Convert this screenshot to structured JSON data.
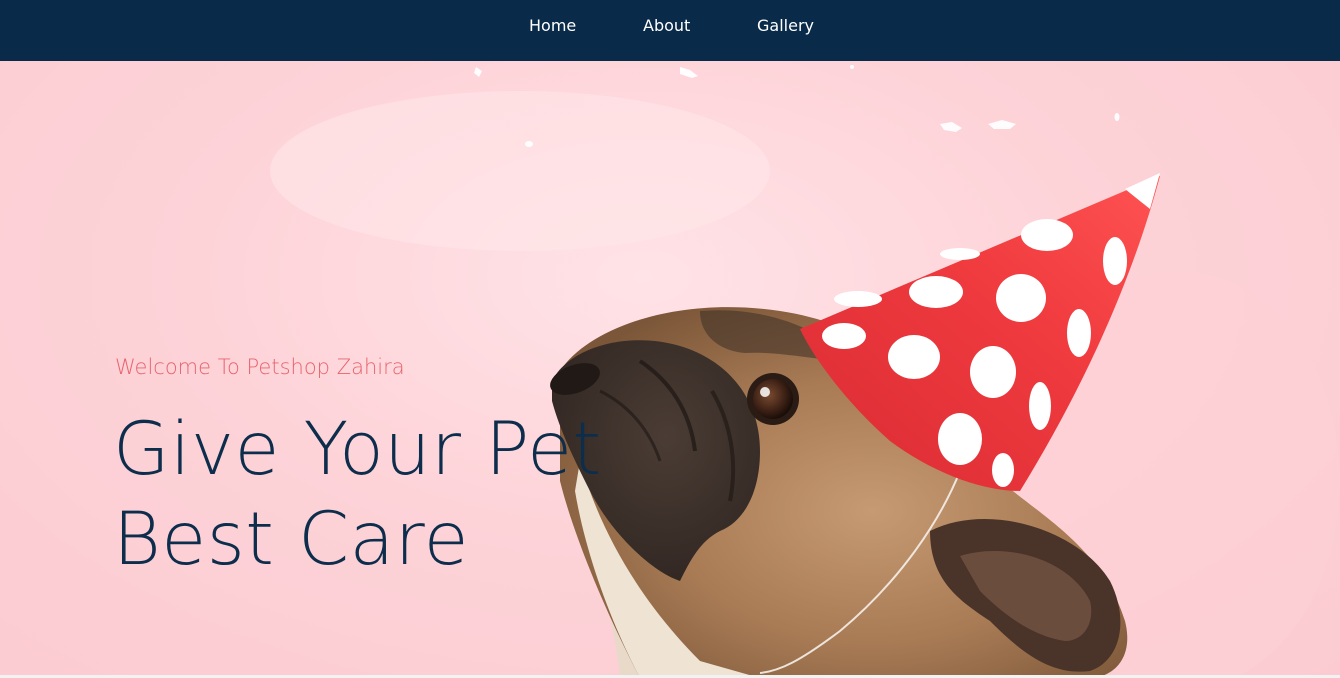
{
  "nav": {
    "items": [
      {
        "label": "Home"
      },
      {
        "label": "About"
      },
      {
        "label": "Gallery"
      }
    ]
  },
  "hero": {
    "subtitle": "Welcome To Petshop Zahira",
    "headline_line1": "Give Your Pet",
    "headline_line2": "Best Care",
    "image_subject": "pug-with-party-hat",
    "colors": {
      "nav_background": "#0a2a4a",
      "background_pink": "#fdd3d8",
      "subtitle": "#e8646d",
      "headline": "#0d2d4c",
      "hat_red": "#f03b3f"
    }
  }
}
